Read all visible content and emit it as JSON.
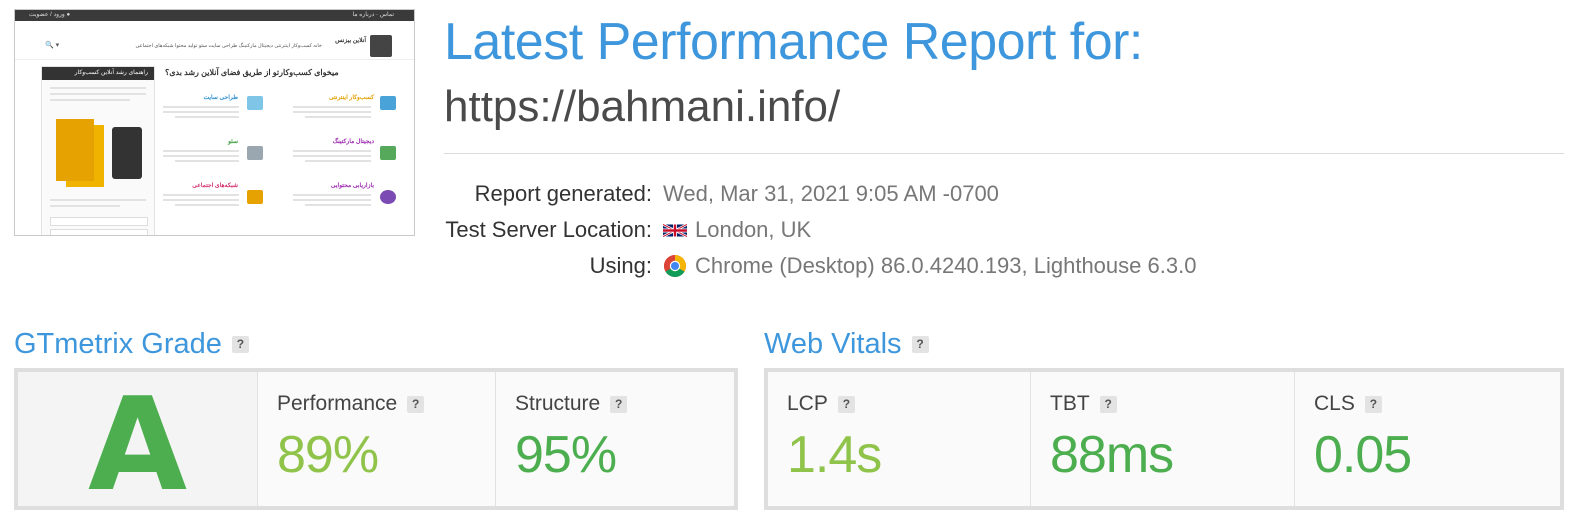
{
  "report": {
    "title": "Latest Performance Report for:",
    "url": "https://bahmani.info/",
    "meta": [
      {
        "label": "Report generated:",
        "value": "Wed, Mar 31, 2021 9:05 AM -0700",
        "icon": ""
      },
      {
        "label": "Test Server Location:",
        "value": "London, UK",
        "icon": "uk-flag-icon"
      },
      {
        "label": "Using:",
        "value": "Chrome (Desktop) 86.0.4240.193, Lighthouse 6.3.0",
        "icon": "chrome-icon"
      }
    ]
  },
  "grade": {
    "title": "GTmetrix Grade",
    "help": "?",
    "letter": "A",
    "metrics": [
      {
        "label": "Performance",
        "help": "?",
        "value": "89%"
      },
      {
        "label": "Structure",
        "help": "?",
        "value": "95%"
      }
    ]
  },
  "vitals": {
    "title": "Web Vitals",
    "help": "?",
    "metrics": [
      {
        "label": "LCP",
        "help": "?",
        "value": "1.4s"
      },
      {
        "label": "TBT",
        "help": "?",
        "value": "88ms"
      },
      {
        "label": "CLS",
        "help": "?",
        "value": "0.05"
      }
    ]
  },
  "thumbnail": {
    "headline": "میخوای کسب‌وکارتو از طریق فضای آنلاین رشد بدی؟",
    "sidebar_title": "راهنمای رشد آنلاین کسب‌وکار",
    "logo_text": "آنلاین بیزنس",
    "nav_items": "خانه   کسب‌وکار اینترنتی   دیجیتال مارکتینگ   طراحی سایت   سئو   تولید محتوا   شبکه‌های اجتماعی",
    "cards": [
      "کسب‌وکار اینترنتی",
      "طراحی سایت",
      "دیجیتال مارکتینگ",
      "سئو",
      "بازاریابی محتوایی",
      "شبکه‌های اجتماعی"
    ]
  },
  "colors": {
    "accent": "#3e97dc",
    "good": "#4cae4f",
    "good_light": "#8fc34a"
  }
}
